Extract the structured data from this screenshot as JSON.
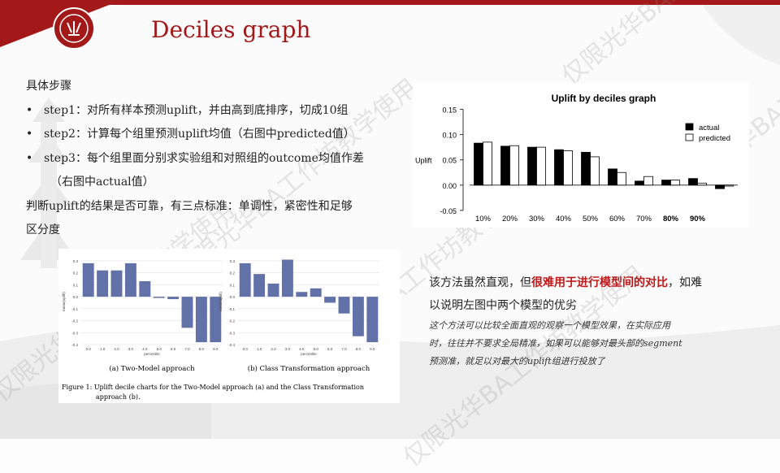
{
  "slide": {
    "title": "Deciles graph"
  },
  "steps": {
    "heading": "具体步骤",
    "items": [
      "step1：对所有样本预测uplift，并由高到底排序，切成10组",
      "step2：计算每个组里预测uplift均值（右图中predicted值）",
      "step3：每个组里面分别求实验组和对照组的outcome均值作差"
    ],
    "item3_cont": "（右图中actual值）",
    "criteria_1": "判断uplift的结果是否可靠，有三点标准：单调性，紧密性和足够",
    "criteria_2": "区分度"
  },
  "right_text": {
    "p1_a": "该方法虽然直观，但",
    "p1_red": "很难用于进行模型间的对比",
    "p1_b": "，如难",
    "p2": "以说明左图中两个模型的优劣",
    "note1": "这个方法可以比较全面直观的观察一个模型效果，在实际应用",
    "note2": "时，往往并不要求全局精准，如果可以能够对最头部的segment",
    "note3": "预测准，就足以对最大的uplift组进行投放了"
  },
  "watermark": {
    "text": "仅限光华BA工作坊教学使用"
  },
  "colors": {
    "brand_red": "#a31818",
    "highlight_red": "#c01818",
    "paper_bar": "#6272a8"
  },
  "icons": {
    "logo": "peking-university-seal"
  },
  "chart_data": [
    {
      "type": "bar",
      "title": "Uplift by deciles graph",
      "ylabel": "Uplift",
      "categories": [
        "10%",
        "20%",
        "30%",
        "40%",
        "50%",
        "60%",
        "70%",
        "80%",
        "90%"
      ],
      "bold_categories": [
        "80%",
        "90%"
      ],
      "series": [
        {
          "name": "actual",
          "color": "#000000",
          "values": [
            0.083,
            0.077,
            0.075,
            0.07,
            0.065,
            0.032,
            0.008,
            0.01,
            0.013,
            -0.007
          ]
        },
        {
          "name": "predicted",
          "color": "#ffffff",
          "values": [
            0.085,
            0.078,
            0.075,
            0.068,
            0.056,
            0.025,
            0.017,
            0.01,
            0.004,
            -0.002
          ]
        }
      ],
      "y_ticks": [
        "0.15",
        "0.10",
        "0.05",
        "0.00",
        "-0.05"
      ],
      "y_tick_values": [
        0.15,
        0.1,
        0.05,
        0.0,
        -0.05
      ],
      "ylim": [
        -0.055,
        0.17
      ],
      "legend_position": "right"
    },
    {
      "type": "bar",
      "xlabel": "percentile",
      "ylabel": "mean(uplift)",
      "caption": "(a) Two-Model approach",
      "categories": [
        "0.0",
        "1.0",
        "2.0",
        "3.0",
        "4.0",
        "5.0",
        "6.0",
        "7.0",
        "8.0",
        "9.0"
      ],
      "values": [
        0.28,
        0.22,
        0.22,
        0.28,
        0.13,
        -0.01,
        -0.02,
        -0.26,
        -0.38,
        -0.38
      ],
      "y_ticks": [
        "0.3",
        "0.2",
        "0.1",
        "0.0",
        "-0.1",
        "-0.2",
        "-0.3",
        "-0.4"
      ],
      "y_tick_values": [
        0.3,
        0.2,
        0.1,
        0.0,
        -0.1,
        -0.2,
        -0.3,
        -0.4
      ],
      "ylim": [
        -0.4,
        0.32
      ]
    },
    {
      "type": "bar",
      "xlabel": "percentile",
      "ylabel": "mean(uplift)",
      "caption": "(b) Class Transformation approach",
      "categories": [
        "0.0",
        "1.0",
        "2.0",
        "3.0",
        "4.0",
        "5.0",
        "6.0",
        "7.0",
        "8.0",
        "9.0"
      ],
      "values": [
        0.28,
        0.19,
        0.11,
        0.31,
        0.04,
        0.07,
        -0.05,
        -0.14,
        -0.33,
        -0.38
      ],
      "y_ticks": [
        "0.3",
        "0.2",
        "0.1",
        "0.0",
        "-0.1",
        "-0.2",
        "-0.3",
        "-0.4"
      ],
      "y_tick_values": [
        0.3,
        0.2,
        0.1,
        0.0,
        -0.1,
        -0.2,
        -0.3,
        -0.4
      ],
      "ylim": [
        -0.4,
        0.32
      ]
    }
  ],
  "figure_caption": {
    "line1": "Figure 1:  Uplift decile charts for the Two-Model approach (a) and the Class Transformation",
    "line2": "approach (b)."
  }
}
